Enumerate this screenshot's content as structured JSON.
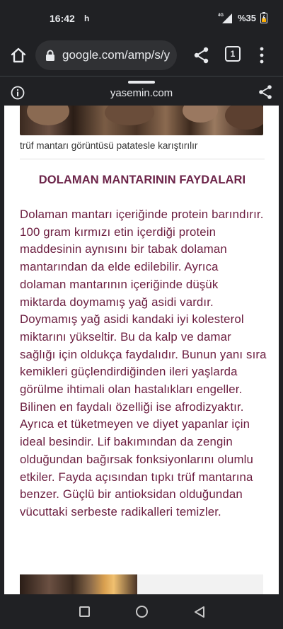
{
  "status_bar": {
    "time": "16:42",
    "indicator": "h",
    "battery": "%35",
    "network_label": "4G",
    "icons": [
      "signal-icon",
      "battery-icon"
    ]
  },
  "browser": {
    "url": "google.com/amp/s/y",
    "tab_count": "1",
    "icons": [
      "home-icon",
      "lock-icon",
      "share-icon",
      "tabs-icon",
      "more-vert-icon"
    ]
  },
  "amp_header": {
    "domain": "yasemin.com",
    "icons": [
      "info-icon",
      "share-icon"
    ]
  },
  "article": {
    "image_caption": "trüf mantarı görüntüsü patatesle karıştırılır",
    "section_heading": "DOLAMAN MANTARININ FAYDALARI",
    "paragraph": "Dolaman mantarı içeriğinde protein barındırır. 100 gram kırmızı etin içerdiği protein maddesinin aynısını bir tabak dolaman mantarından da elde edilebilir. Ayrıca dolaman mantarının içeriğinde düşük miktarda doymamış yağ asidi vardır. Doymamış yağ asidi kandaki iyi kolesterol miktarını yükseltir. Bu da kalp ve damar sağlığı için oldukça faydalıdır. Bunun yanı sıra kemikleri güçlendirdiğinden ileri yaşlarda görülme ihtimali olan hastalıkları engeller. Bilinen en faydalı özelliği ise afrodizyaktır. Ayrıca et tüketmeyen ve diyet yapanlar için ideal besindir. Lif bakımından da zengin olduğundan bağırsak fonksiyonlarını olumlu etkiler. Fayda açısından tıpkı trüf mantarına benzer. Güçlü bir antioksidan olduğundan vücuttaki serbeste radikalleri temizler."
  },
  "nav_bar": {
    "icons": [
      "recents-icon",
      "home-circle-icon",
      "back-icon"
    ]
  },
  "colors": {
    "heading": "#6b2348",
    "body_text": "#6b1d3f",
    "chrome_bg": "#202124"
  }
}
